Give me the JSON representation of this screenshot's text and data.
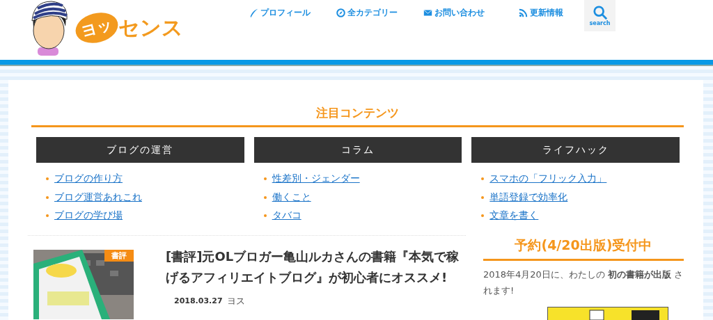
{
  "logo": {
    "bubble": "ヨッ",
    "text": "センス"
  },
  "nav": [
    {
      "kind": "pen",
      "label": "プロフィール"
    },
    {
      "kind": "compass",
      "label": "全カテゴリー"
    },
    {
      "kind": "mail",
      "label": "お問い合わせ"
    },
    {
      "kind": "rss",
      "label": "更新情報"
    }
  ],
  "search": {
    "label": "search"
  },
  "featured": {
    "title": "注目コンテンツ",
    "columns": [
      {
        "heading": "ブログの運営",
        "links": [
          "ブログの作り方",
          "ブログ運営あれこれ",
          "ブログの学び場"
        ]
      },
      {
        "heading": "コラム",
        "links": [
          "性差別・ジェンダー",
          "働くこと",
          "タバコ"
        ]
      },
      {
        "heading": "ライフハック",
        "links": [
          "スマホの「フリック入力」",
          "単語登録で効率化",
          "文章を書く"
        ]
      }
    ]
  },
  "post": {
    "category": "書評",
    "title": "[書評]元OLブロガー亀山ルカさんの書籍『本気で稼げるアフィリエイトブログ』が初心者にオススメ!",
    "date": "2018.03.27",
    "author": "ヨス"
  },
  "sidebar": {
    "heading": "予約(4/20出版)受付中",
    "text": "2018年4月20日に、わたしの **初の書籍が出版** されます!"
  }
}
